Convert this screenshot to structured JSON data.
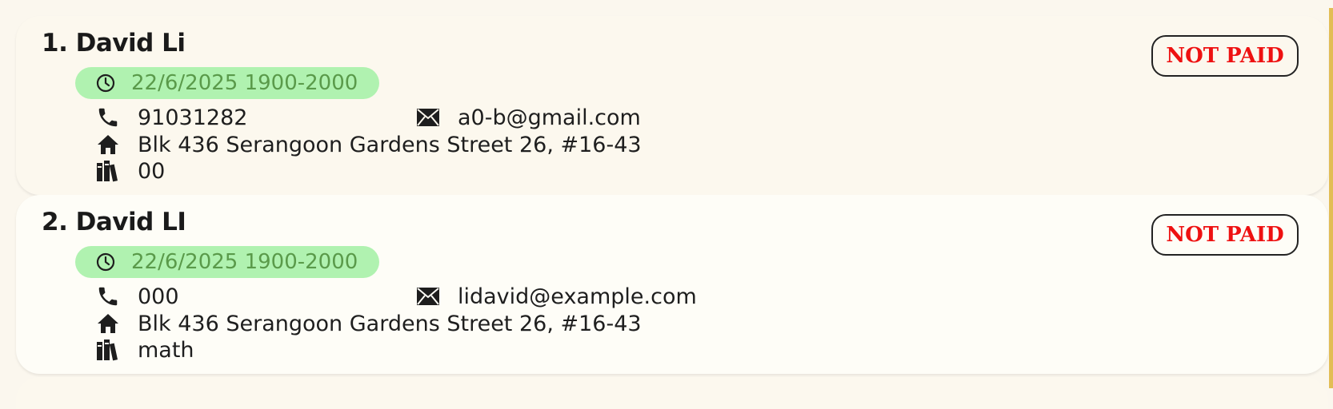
{
  "students": [
    {
      "name": "1. David Li",
      "schedule": "22/6/2025 1900-2000",
      "phone": "91031282",
      "email": "a0-b@gmail.com",
      "address": "Blk 436 Serangoon Gardens Street 26, #16-43",
      "subject": "00",
      "status": "NOT PAID"
    },
    {
      "name": "2. David LI",
      "schedule": "22/6/2025 1900-2000",
      "phone": "000",
      "email": "lidavid@example.com",
      "address": "Blk 436 Serangoon Gardens Street 26, #16-43",
      "subject": "math",
      "status": "NOT PAID"
    }
  ],
  "colors": {
    "schedule_bg": "#b0f2b0",
    "schedule_text": "#5a9a4a",
    "status_text": "#ee1111",
    "card_odd": "#fcf8ee",
    "card_even": "#fefdf7",
    "accent_edge": "#e2bd55"
  },
  "icons": {
    "schedule": "clock-icon",
    "phone": "phone-icon",
    "email": "envelope-icon",
    "address": "home-icon",
    "subject": "books-icon"
  }
}
